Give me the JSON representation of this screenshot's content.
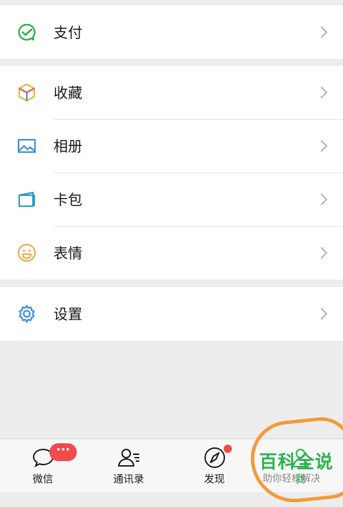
{
  "groups": [
    {
      "items": [
        {
          "label": "支付",
          "icon": "wallet-check-icon"
        }
      ]
    },
    {
      "items": [
        {
          "label": "收藏",
          "icon": "cube-favorites-icon"
        },
        {
          "label": "相册",
          "icon": "photo-album-icon"
        },
        {
          "label": "卡包",
          "icon": "card-wallet-icon"
        },
        {
          "label": "表情",
          "icon": "smiley-icon"
        }
      ]
    },
    {
      "items": [
        {
          "label": "设置",
          "icon": "gear-icon"
        }
      ]
    }
  ],
  "tabbar": {
    "tabs": [
      {
        "label": "微信",
        "icon": "chat-bubble-icon",
        "badge": "···"
      },
      {
        "label": "通讯录",
        "icon": "contacts-icon"
      },
      {
        "label": "发现",
        "icon": "compass-icon",
        "dot": true
      },
      {
        "label": "我",
        "icon": "person-icon"
      }
    ]
  },
  "watermark": {
    "title": "百科全说",
    "subtitle": "助你轻松解决"
  },
  "colors": {
    "accent_green": "#2bb24c",
    "badge_red": "#f04a4a",
    "watermark_orange": "#f39a3a",
    "background": "#ededed"
  }
}
